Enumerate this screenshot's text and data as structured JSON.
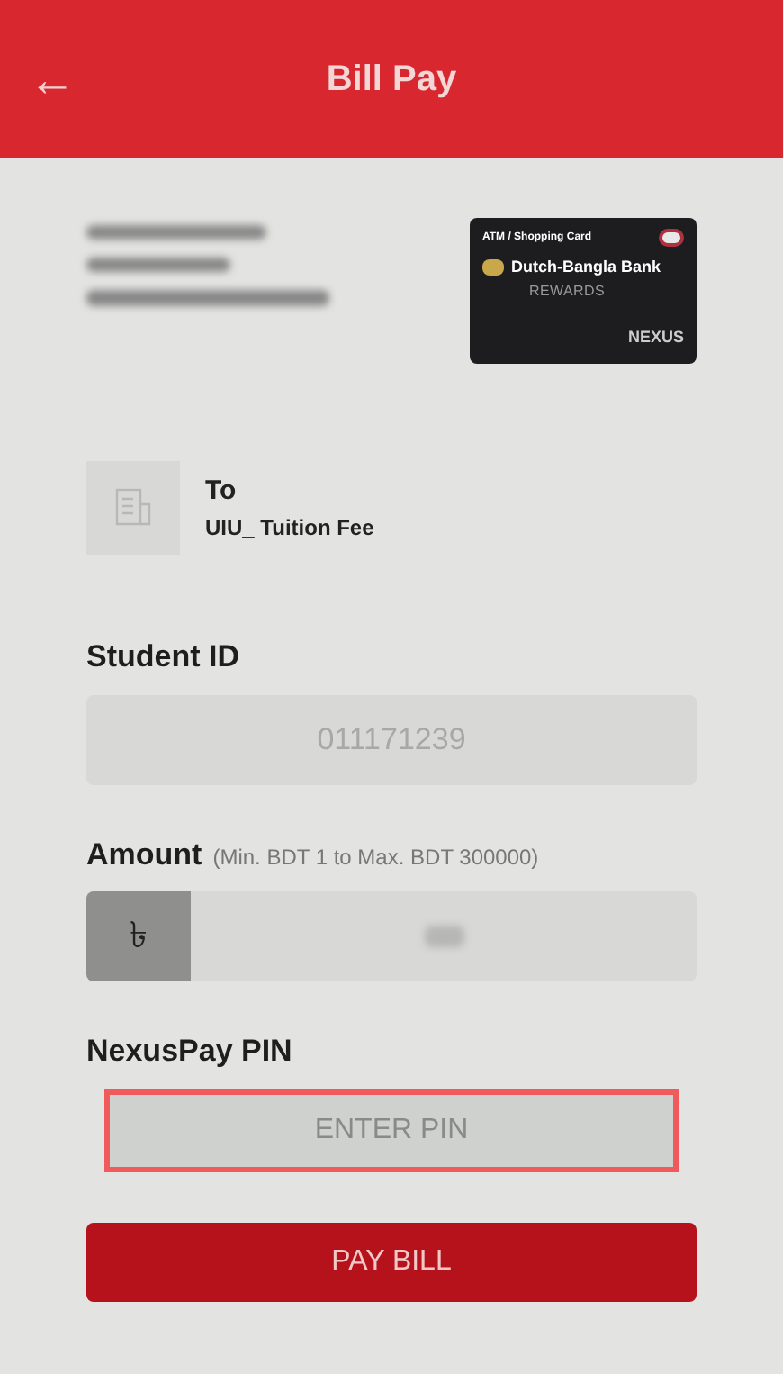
{
  "header": {
    "back_icon": "←",
    "title": "Bill Pay"
  },
  "card": {
    "type_label": "ATM / Shopping Card",
    "bank": "Dutch-Bangla Bank",
    "program": "REWARDS",
    "brand": "NEXUS"
  },
  "recipient": {
    "label": "To",
    "name": "UIU_ Tuition Fee"
  },
  "fields": [
    {
      "kind": "text",
      "label": "Student ID",
      "value": "011171239"
    },
    {
      "kind": "amount",
      "label": "Amount",
      "hint": "(Min. BDT 1 to Max. BDT 300000)",
      "currency": "৳"
    },
    {
      "kind": "pin",
      "label": "NexusPay PIN",
      "placeholder": "ENTER PIN",
      "highlighted": true
    }
  ],
  "submit": {
    "label": "PAY BILL"
  }
}
